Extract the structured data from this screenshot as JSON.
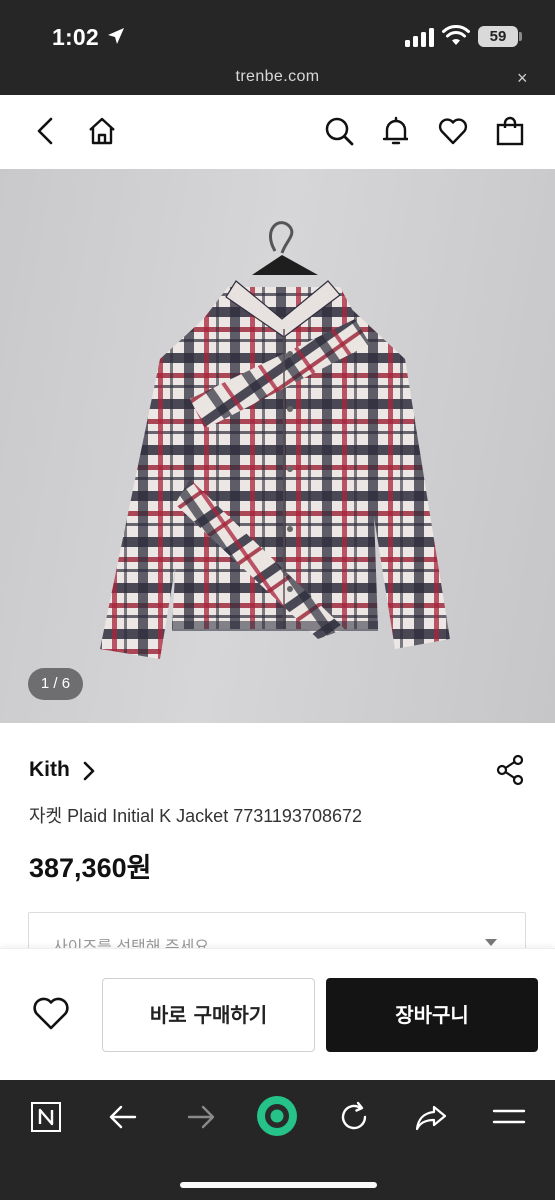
{
  "status_bar": {
    "time": "1:02",
    "battery": "59"
  },
  "browser": {
    "url": "trenbe.com",
    "close": "×"
  },
  "header": {
    "icons": [
      "back-icon",
      "home-icon",
      "search-icon",
      "bell-icon",
      "heart-icon",
      "bag-icon"
    ]
  },
  "product": {
    "image_counter": "1 / 6",
    "brand": "Kith",
    "name": "자켓 Plaid Initial K Jacket 7731193708672",
    "price": "387,360원",
    "size_placeholder": "사이즈를 선택해 주세요"
  },
  "actions": {
    "buy_now": "바로 구매하기",
    "cart": "장바구니"
  },
  "toolbar": {
    "icons": [
      "naver-n-icon",
      "back-arrow-icon",
      "forward-arrow-icon",
      "green-dot-icon",
      "refresh-icon",
      "share-arrow-icon",
      "menu-icon"
    ]
  },
  "colors": {
    "dark_bar": "#262626",
    "accent_green": "#25c28a",
    "cart_button": "#141414"
  }
}
